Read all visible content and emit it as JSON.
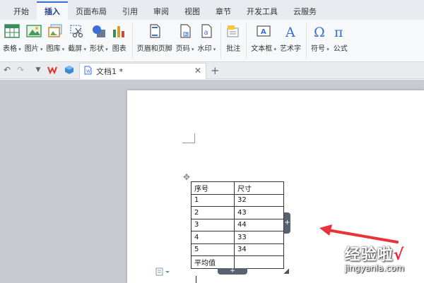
{
  "menu": {
    "tabs": [
      "开始",
      "插入",
      "页面布局",
      "引用",
      "审阅",
      "视图",
      "章节",
      "开发工具",
      "云服务"
    ],
    "active": "插入"
  },
  "ribbon": {
    "buttons": [
      {
        "label": "表格",
        "icon": "table-icon",
        "dropdown": true
      },
      {
        "label": "图片",
        "icon": "picture-icon",
        "dropdown": true
      },
      {
        "label": "图库",
        "icon": "gallery-icon",
        "dropdown": true
      },
      {
        "label": "截屏",
        "icon": "screenshot-icon",
        "dropdown": true
      },
      {
        "label": "形状",
        "icon": "shapes-icon",
        "dropdown": true
      },
      {
        "label": "图表",
        "icon": "chart-icon",
        "dropdown": false
      },
      {
        "label": "页眉和页脚",
        "icon": "header-footer-icon",
        "dropdown": false
      },
      {
        "label": "页码",
        "icon": "page-number-icon",
        "dropdown": true
      },
      {
        "label": "水印",
        "icon": "watermark-icon",
        "dropdown": true
      },
      {
        "label": "批注",
        "icon": "comment-icon",
        "dropdown": false
      },
      {
        "label": "文本框",
        "icon": "textbox-icon",
        "dropdown": true
      },
      {
        "label": "艺术字",
        "icon": "wordart-icon",
        "dropdown": false
      },
      {
        "label": "符号",
        "icon": "symbol-icon",
        "dropdown": true
      },
      {
        "label": "公式",
        "icon": "formula-icon",
        "dropdown": false
      }
    ]
  },
  "document": {
    "tab_title": "文档1 *",
    "table": {
      "rows": [
        [
          "序号",
          "尺寸"
        ],
        [
          "1",
          "32"
        ],
        [
          "2",
          "43"
        ],
        [
          "3",
          "44"
        ],
        [
          "4",
          "33"
        ],
        [
          "5",
          "34"
        ],
        [
          "平均值",
          ""
        ]
      ]
    }
  },
  "watermark": {
    "text": "经验啦",
    "tick": "√",
    "url": "jingyanla.com"
  },
  "colors": {
    "accent": "#3b6fd4",
    "arrow": "#e8333a"
  }
}
